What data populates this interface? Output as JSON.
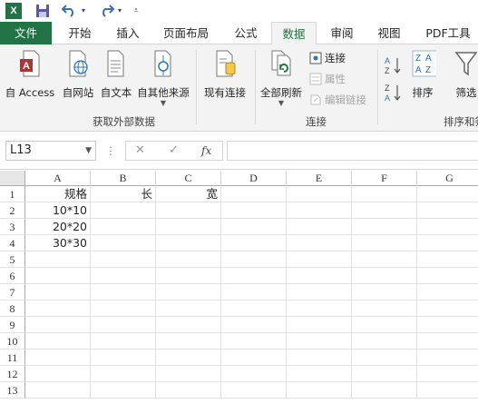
{
  "quick_access": {
    "app_icon": "excel-icon",
    "app_letter": "X",
    "save": "save-icon",
    "undo": "undo-icon",
    "redo": "redo-icon",
    "customize": "customize-icon"
  },
  "tabs": [
    "文件",
    "开始",
    "插入",
    "页面布局",
    "公式",
    "数据",
    "审阅",
    "视图",
    "PDF工具"
  ],
  "active_tab": "数据",
  "ribbon": {
    "external_group": {
      "label": "获取外部数据",
      "buttons": [
        {
          "label": "自 Access",
          "icon": "access-icon"
        },
        {
          "label": "自网站",
          "icon": "web-icon"
        },
        {
          "label": "自文本",
          "icon": "text-file-icon"
        },
        {
          "label": "自其他来源",
          "icon": "other-sources-icon"
        }
      ]
    },
    "existing_connections": {
      "label": "现有连接",
      "icon": "existing-connections-icon"
    },
    "connections_group": {
      "label": "连接",
      "refresh_all": "全部刷新",
      "small_items": [
        "连接",
        "属性",
        "编辑链接"
      ]
    },
    "sort_group": {
      "label": "排序和筛",
      "sort": "排序",
      "filter": "筛选"
    }
  },
  "formula_bar": {
    "name_box": "L13",
    "cancel": "✕",
    "enter": "✓",
    "fx": "fx",
    "value": ""
  },
  "grid": {
    "columns": [
      "A",
      "B",
      "C",
      "D",
      "E",
      "F",
      "G"
    ],
    "rows": [
      "1",
      "2",
      "3",
      "4",
      "5",
      "6",
      "7",
      "8",
      "9",
      "10",
      "11",
      "12",
      "13"
    ],
    "cells": [
      [
        "规格",
        "长",
        "宽",
        "",
        "",
        "",
        ""
      ],
      [
        "10*10",
        "",
        "",
        "",
        "",
        "",
        ""
      ],
      [
        "20*20",
        "",
        "",
        "",
        "",
        "",
        ""
      ],
      [
        "30*30",
        "",
        "",
        "",
        "",
        "",
        ""
      ]
    ]
  },
  "colors": {
    "accent": "#217346",
    "ribbon_bg": "#f3f3f3"
  }
}
